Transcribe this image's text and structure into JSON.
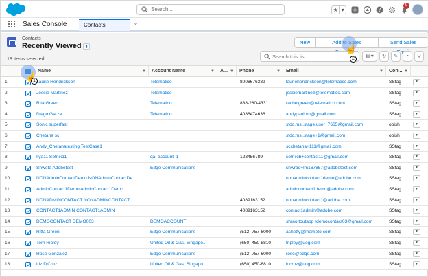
{
  "header": {
    "search_placeholder": "Search...",
    "notification_count": "9",
    "icons": [
      "favorites-star-icon",
      "add-icon",
      "trailhead-icon",
      "help-icon",
      "setup-gear-icon",
      "notifications-bell-icon",
      "user-avatar"
    ]
  },
  "app": {
    "name": "Sales Console",
    "tab": "Contacts"
  },
  "list": {
    "object_label": "Contacts",
    "view_name": "Recently Viewed",
    "items_selected": "18 items selected",
    "search_placeholder": "Search this list...",
    "buttons": {
      "new": "New",
      "add_to_campaign": "Add to Sales Campaign",
      "send_email": "Send Sales Email"
    }
  },
  "table": {
    "columns": {
      "name": "Name",
      "account": "Account Name",
      "a": "A...",
      "phone": "Phone",
      "email": "Email",
      "con": "Con..."
    },
    "rows": [
      {
        "n": "1",
        "name": "Laurie Hendrickson",
        "account": "Telematico",
        "phone": "8006676389",
        "email": "lauriehendrickson@telematico.com",
        "con": "SStag"
      },
      {
        "n": "2",
        "name": "Jessie Martinez",
        "account": "Telematico",
        "phone": "",
        "email": "jessiemartinez@telematico.com",
        "con": "SStag"
      },
      {
        "n": "3",
        "name": "Rita Green",
        "account": "Telematico",
        "phone": "888-280-4331",
        "email": "rachelgreen@telematico.com",
        "con": "SStag"
      },
      {
        "n": "4",
        "name": "Diego Garza",
        "account": "Telematico",
        "phone": "4086474636",
        "email": "andypaulpm@gmail.com",
        "con": "SStag"
      },
      {
        "n": "5",
        "name": "Sonic superfast",
        "account": "",
        "phone": "",
        "email": "sfdc.msl.stage.user+7665@gmail.com",
        "con": "obish"
      },
      {
        "n": "6",
        "name": "Chetana sc",
        "account": "",
        "phone": "",
        "email": "sfdc.msl.stage+1@gmail.com",
        "con": "obish"
      },
      {
        "n": "7",
        "name": "Andy_Chetanatesting TestCase1",
        "account": "",
        "phone": "",
        "email": "scchetana+111@gmail.com",
        "con": "SStag"
      },
      {
        "n": "8",
        "name": "Ilya11 Sotnik11",
        "account": "qa_account_1",
        "phone": "123456789",
        "email": "sotnikib+contact11@gmail.com",
        "con": "SStag"
      },
      {
        "n": "9",
        "name": "Shweta Adobetest",
        "account": "Edge Communications",
        "phone": "",
        "email": "shwrao+lm167857@adobetest.com",
        "con": "SStag"
      },
      {
        "n": "10",
        "name": "NONAdminContactDemo NONAdminContactDe...",
        "account": "",
        "phone": "",
        "email": "nonadmincontact1demo@adobe.com",
        "con": "SStag"
      },
      {
        "n": "11",
        "name": "AdminContact1Demo AdminContact1Demo",
        "account": "",
        "phone": "",
        "email": "admincontact1demo@adobe.com",
        "con": "SStag"
      },
      {
        "n": "12",
        "name": "NONADMINCONTACT NONADMINCONTACT",
        "account": "",
        "phone": "4089163152",
        "email": "nonadmincontact1@adobe.com",
        "con": "SStag"
      },
      {
        "n": "13",
        "name": "CONTACT1ADMIN CONTACT1ADMIN",
        "account": "",
        "phone": "4089163152",
        "email": "contact1admin@adobe.com",
        "con": "SStag"
      },
      {
        "n": "14",
        "name": "DEMOCONTACT DEMO003",
        "account": "DEMOACCOUNT",
        "phone": "",
        "email": "shrao.toutapp+democontact03@gmail.com",
        "con": "SStag"
      },
      {
        "n": "15",
        "name": "Ritta Green",
        "account": "Edge Communications",
        "phone": "(512) 757-6000",
        "email": "ashetty@marketo.com",
        "con": "SStag"
      },
      {
        "n": "16",
        "name": "Tom Ripley",
        "account": "United Oil & Gas, Singapo...",
        "phone": "(650) 450-8810",
        "email": "tripley@uog.com",
        "con": "SStag"
      },
      {
        "n": "17",
        "name": "Rose Gonzalez",
        "account": "Edge Communications",
        "phone": "(512) 757-6000",
        "email": "rose@edge.com",
        "con": "SStag"
      },
      {
        "n": "18",
        "name": "Liz D'Cruz",
        "account": "United Oil & Gas, Singapo...",
        "phone": "(650) 450-8810",
        "email": "ldcruz@uog.com",
        "con": "SStag"
      }
    ]
  },
  "callouts": {
    "step1": "1",
    "step2": "2"
  },
  "colors": {
    "brand_blue": "#0176d3",
    "logo_blue": "#00a1e0",
    "object_icon": "#3c5ec2"
  }
}
